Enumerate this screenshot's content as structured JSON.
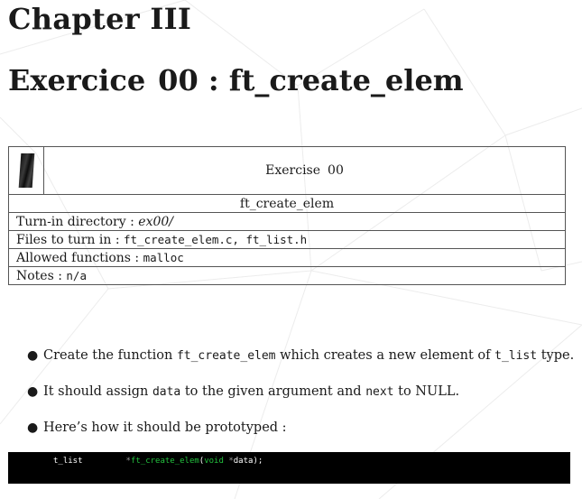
{
  "chapter": {
    "title": "Chapter III"
  },
  "exercise": {
    "heading_prefix": "Exercice",
    "heading_number": "00",
    "heading_sep": ":",
    "heading_name": "ft_create_elem"
  },
  "table": {
    "exercise_label": "Exercise",
    "exercise_number": "00",
    "name": "ft_create_elem",
    "turnin_label": "Turn-in directory :",
    "turnin_value": "ex00/",
    "files_label": "Files to turn in :",
    "files_value": "ft_create_elem.c, ft_list.h",
    "allowed_label": "Allowed functions :",
    "allowed_value": "malloc",
    "notes_label": "Notes :",
    "notes_value": "n/a"
  },
  "bullets": [
    {
      "pre": "Create the function",
      "code1": "ft_create_elem",
      "mid": "which creates a new element of",
      "code2": "t_list",
      "post": "type."
    },
    {
      "pre": "It should assign",
      "code1": "data",
      "mid": "to the given argument and",
      "code2": "next",
      "post": "to NULL."
    },
    {
      "text": "Here’s how it should be prototyped :"
    }
  ],
  "code": {
    "type": "t_list",
    "star": "*",
    "func": "ft_create_elem",
    "paren_open": "(",
    "kw": "void",
    "star2": "*",
    "arg": "data",
    "tail": ");"
  }
}
